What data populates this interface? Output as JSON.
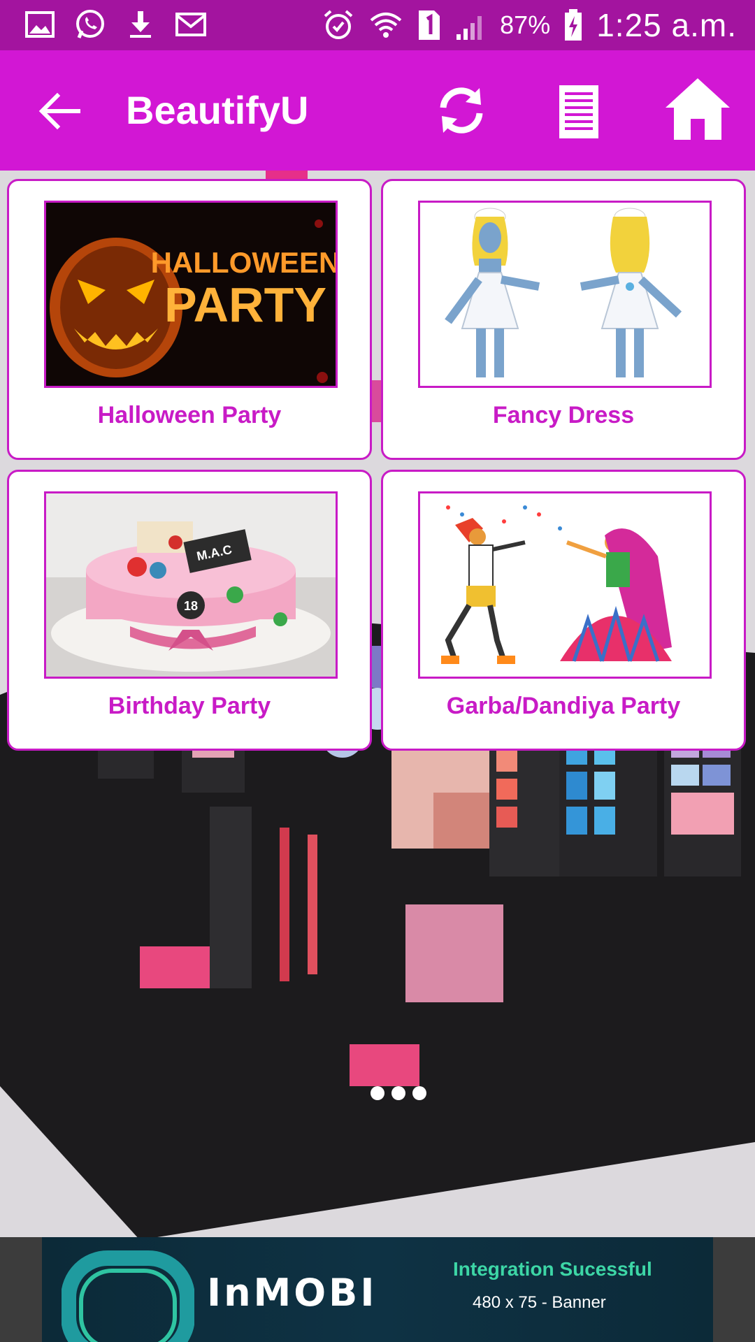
{
  "status_bar": {
    "left_icons": [
      "gallery-icon",
      "whatsapp-icon",
      "download-icon",
      "gmail-icon"
    ],
    "right_icons": [
      "alarm-icon",
      "wifi-icon",
      "sim-1-icon",
      "signal-icon",
      "battery-charging-icon"
    ],
    "battery_percent": "87%",
    "time": "1:25 a.m."
  },
  "app_bar": {
    "title": "BeautifyU",
    "back_icon": "arrow-left-icon",
    "actions": [
      "refresh-icon",
      "list-icon",
      "home-icon"
    ]
  },
  "categories": [
    {
      "label": "Halloween Party",
      "image": "halloween-party-image"
    },
    {
      "label": "Fancy Dress",
      "image": "fancy-dress-image"
    },
    {
      "label": "Birthday Party",
      "image": "birthday-party-image"
    },
    {
      "label": "Garba/Dandiya Party",
      "image": "garba-dandiya-image"
    }
  ],
  "images": {
    "halloween_text_1": "HALLOWEEN",
    "halloween_text_2": "PARTY",
    "cake_text": "M.A.C",
    "cake_number": "18"
  },
  "ad": {
    "brand": "InMOBI",
    "title": "Integration Sucessful",
    "subtitle": "480 x 75 - Banner"
  },
  "colors": {
    "status_bar": "#a3149f",
    "app_bar": "#d217d4",
    "accent": "#c81bc6",
    "ad_background": "#0c2a38",
    "ad_title": "#3dd6a6"
  }
}
